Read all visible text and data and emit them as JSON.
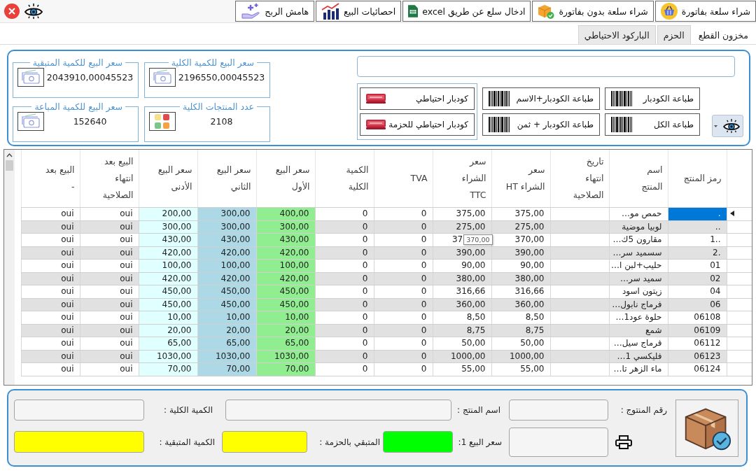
{
  "toolbar": [
    {
      "label": "شراء سلعة بفاتورة",
      "kind": "basket"
    },
    {
      "label": "شراء سلعة بدون بفاتورة",
      "kind": "package"
    },
    {
      "label": "ادخال سلع عن طريق excel",
      "kind": "spreadsheet"
    },
    {
      "label": "احصائيات البيع",
      "kind": "chart"
    },
    {
      "label": "هامش الربح",
      "kind": "hand"
    }
  ],
  "tabs": [
    {
      "label": "مخزون القطع",
      "selected": true
    },
    {
      "label": "الحزم",
      "selected": false
    },
    {
      "label": "الباركود الاحتياطي",
      "selected": false
    }
  ],
  "stats": [
    {
      "label": "سعر البيع للكمية الكلية",
      "value": "2196550,00045523",
      "kind": "money"
    },
    {
      "label": "سعر البيع للكمية المتبقية",
      "value": "2043910,00045523",
      "kind": "money"
    },
    {
      "label": "عدد المنتجات الكلية",
      "value": "2108",
      "kind": "tiles"
    },
    {
      "label": "سعر البيع للكمية المباعة",
      "value": "152640",
      "kind": "money"
    }
  ],
  "print_buttons": [
    {
      "label": "طباعة الكودبار"
    },
    {
      "label": "طباعة الكودبار+الاسم"
    },
    {
      "label": "طباعة الكل"
    },
    {
      "label": "طباعة الكودبار + ثمن"
    }
  ],
  "reserve_buttons": [
    {
      "label": "كودبار احتياطي"
    },
    {
      "label": "كودبار احتياطي للحزمة"
    }
  ],
  "table": {
    "columns": [
      {
        "label": "رمز المنتج"
      },
      {
        "label": "اسم\nالمنتج"
      },
      {
        "label": "تاريخ\nانتهاء\nالصلاحية"
      },
      {
        "label": "سعر\nالشراء HT"
      },
      {
        "label": "سعر\nالشراء\nTTC"
      },
      {
        "label": "TVA"
      },
      {
        "label": "الكمية\nالكلية"
      },
      {
        "label": "سعر البيع\nالأول",
        "color": "#90ee90"
      },
      {
        "label": "سعر البيع\nالثاني",
        "color": "#add8e6"
      },
      {
        "label": "سعر البيع\nالأدنى",
        "color": "#e0ffff"
      },
      {
        "label": "البيع بعد\nانتهاء\nالصلاحية"
      },
      {
        "label": "البيع بعد\n-"
      }
    ],
    "rows": [
      {
        "code": ".",
        "name": "حمص مو…",
        "purchase_ht": "375,00",
        "purchase_ttc": "375,00",
        "tva": "0",
        "total_quantity": "0",
        "sale_price_1": "400,00",
        "sale_price_2": "300,00",
        "sale_price_min": "200,00",
        "sale_after_expiry": "oui",
        "column_13": "oui",
        "selected": true
      },
      {
        "code": "..",
        "name": "لوبيا موضية",
        "purchase_ht": "275,00",
        "purchase_ttc": "275,00",
        "tva": "0",
        "total_quantity": "0",
        "sale_price_1": "300,00",
        "sale_price_2": "300,00",
        "sale_price_min": "300,00",
        "sale_after_expiry": "oui",
        "column_13": "oui",
        "selected": false
      },
      {
        "code": "1..",
        "name": "مقارون 5ك…",
        "purchase_ht": "370,00",
        "purchase_ttc": "37",
        "tooltip": "370,00",
        "tva": "0",
        "total_quantity": "0",
        "sale_price_1": "430,00",
        "sale_price_2": "430,00",
        "sale_price_min": "430,00",
        "sale_after_expiry": "oui",
        "column_13": "oui",
        "selected": false
      },
      {
        "code": "2.",
        "name": "سسميد سر…",
        "purchase_ht": "390,00",
        "purchase_ttc": "390,00",
        "tva": "0",
        "total_quantity": "0",
        "sale_price_1": "420,00",
        "sale_price_2": "420,00",
        "sale_price_min": "420,00",
        "sale_after_expiry": "oui",
        "column_13": "oui",
        "selected": false
      },
      {
        "code": "01",
        "name": "حليب+لبن ا…",
        "purchase_ht": "90,00",
        "purchase_ttc": "90,00",
        "tva": "0",
        "total_quantity": "0",
        "sale_price_1": "100,00",
        "sale_price_2": "100,00",
        "sale_price_min": "100,00",
        "sale_after_expiry": "oui",
        "column_13": "oui",
        "selected": false
      },
      {
        "code": "02",
        "name": "سميد سر…",
        "purchase_ht": "380,00",
        "purchase_ttc": "380,00",
        "tva": "0",
        "total_quantity": "0",
        "sale_price_1": "420,00",
        "sale_price_2": "420,00",
        "sale_price_min": "420,00",
        "sale_after_expiry": "oui",
        "column_13": "oui",
        "selected": false
      },
      {
        "code": "04",
        "name": "زيتون اسود",
        "purchase_ht": "316,66",
        "purchase_ttc": "316,66",
        "tva": "0",
        "total_quantity": "0",
        "sale_price_1": "450,00",
        "sale_price_2": "450,00",
        "sale_price_min": "450,00",
        "sale_after_expiry": "oui",
        "column_13": "oui",
        "selected": false
      },
      {
        "code": "06",
        "name": "فرماج نابول…",
        "purchase_ht": "360,00",
        "purchase_ttc": "360,00",
        "tva": "0",
        "total_quantity": "0",
        "sale_price_1": "450,00",
        "sale_price_2": "450,00",
        "sale_price_min": "450,00",
        "sale_after_expiry": "oui",
        "column_13": "oui",
        "selected": false
      },
      {
        "code": "06108",
        "name": "حلوة عود1…",
        "purchase_ht": "8,50",
        "purchase_ttc": "8,50",
        "tva": "0",
        "total_quantity": "0",
        "sale_price_1": "10,00",
        "sale_price_2": "10,00",
        "sale_price_min": "10,00",
        "sale_after_expiry": "oui",
        "column_13": "oui",
        "selected": false
      },
      {
        "code": "06109",
        "name": "شمع",
        "purchase_ht": "8,75",
        "purchase_ttc": "8,75",
        "tva": "0",
        "total_quantity": "0",
        "sale_price_1": "20,00",
        "sale_price_2": "20,00",
        "sale_price_min": "20,00",
        "sale_after_expiry": "oui",
        "column_13": "oui",
        "selected": false
      },
      {
        "code": "06112",
        "name": "فرماج سيل…",
        "purchase_ht": "50,00",
        "purchase_ttc": "50,00",
        "tva": "0",
        "total_quantity": "0",
        "sale_price_1": "65,00",
        "sale_price_2": "65,00",
        "sale_price_min": "65,00",
        "sale_after_expiry": "oui",
        "column_13": "oui",
        "selected": false
      },
      {
        "code": "06123",
        "name": "فليكسي 1…",
        "purchase_ht": "1000,00",
        "purchase_ttc": "1000,00",
        "tva": "0",
        "total_quantity": "0",
        "sale_price_1": "1030,00",
        "sale_price_2": "1030,00",
        "sale_price_min": "1030,00",
        "sale_after_expiry": "oui",
        "column_13": "oui",
        "selected": false
      },
      {
        "code": "06124",
        "name": "ماء الزهر تا…",
        "purchase_ht": "55,00",
        "purchase_ttc": "55,00",
        "tva": "0",
        "total_quantity": "0",
        "sale_price_1": "70,00",
        "sale_price_2": "70,00",
        "sale_price_min": "70,00",
        "sale_after_expiry": "oui",
        "column_13": "oui",
        "selected": false
      }
    ]
  },
  "details": {
    "row_1": [
      {
        "kind": "field",
        "label": "رقم المنتوج :"
      },
      {
        "kind": "field",
        "label": "اسم المنتج :"
      },
      {
        "kind": "field",
        "label": "الكمية الكلية :"
      }
    ],
    "row_2": [
      {
        "kind": "print"
      },
      {
        "kind": "field",
        "label": "سعر البيع 1:",
        "color": "#00ff00"
      },
      {
        "kind": "field",
        "label": "المتبقي بالحزمة :",
        "color": "#ffff00"
      },
      {
        "kind": "field",
        "label": "الكمية المتبقية :",
        "color": "#ffff00"
      }
    ]
  }
}
